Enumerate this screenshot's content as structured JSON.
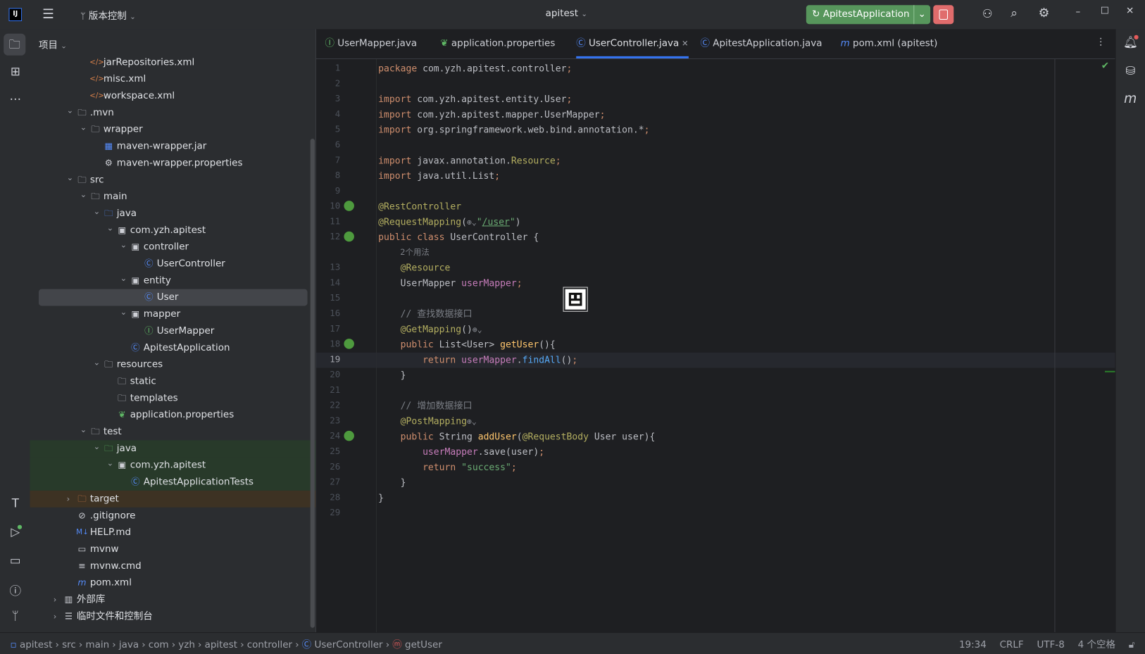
{
  "titlebar": {
    "app_icon": "IJ",
    "menu_icon": "hamburger-icon",
    "vcs_label": "版本控制",
    "project_name": "apitest",
    "run_config": "ApitestApplication",
    "run_color": "#57965c",
    "stop_color": "#e06c6c"
  },
  "project_panel": {
    "title": "项目",
    "items": [
      {
        "level": 2,
        "chev": "",
        "icon": "xml",
        "label": "jarRepositories.xml",
        "style": ""
      },
      {
        "level": 2,
        "chev": "",
        "icon": "xml",
        "label": "misc.xml",
        "style": ""
      },
      {
        "level": 2,
        "chev": "",
        "icon": "xml",
        "label": "workspace.xml",
        "style": ""
      },
      {
        "level": 1,
        "chev": "open",
        "icon": "folder",
        "label": ".mvn",
        "style": ""
      },
      {
        "level": 2,
        "chev": "open",
        "icon": "folder",
        "label": "wrapper",
        "style": ""
      },
      {
        "level": 3,
        "chev": "",
        "icon": "jar",
        "label": "maven-wrapper.jar",
        "style": ""
      },
      {
        "level": 3,
        "chev": "",
        "icon": "gear",
        "label": "maven-wrapper.properties",
        "style": ""
      },
      {
        "level": 1,
        "chev": "open",
        "icon": "folder",
        "label": "src",
        "style": ""
      },
      {
        "level": 2,
        "chev": "open",
        "icon": "folder",
        "label": "main",
        "style": ""
      },
      {
        "level": 3,
        "chev": "open",
        "icon": "srcfolder",
        "label": "java",
        "style": ""
      },
      {
        "level": 4,
        "chev": "open",
        "icon": "package",
        "label": "com.yzh.apitest",
        "style": ""
      },
      {
        "level": 5,
        "chev": "open",
        "icon": "package",
        "label": "controller",
        "style": ""
      },
      {
        "level": 6,
        "chev": "",
        "icon": "class",
        "label": "UserController",
        "style": ""
      },
      {
        "level": 5,
        "chev": "open",
        "icon": "package",
        "label": "entity",
        "style": ""
      },
      {
        "level": 6,
        "chev": "",
        "icon": "class",
        "label": "User",
        "style": "sel"
      },
      {
        "level": 5,
        "chev": "open",
        "icon": "package",
        "label": "mapper",
        "style": ""
      },
      {
        "level": 6,
        "chev": "",
        "icon": "interface",
        "label": "UserMapper",
        "style": ""
      },
      {
        "level": 5,
        "chev": "",
        "icon": "springclass",
        "label": "ApitestApplication",
        "style": ""
      },
      {
        "level": 3,
        "chev": "open",
        "icon": "resfolder",
        "label": "resources",
        "style": ""
      },
      {
        "level": 4,
        "chev": "",
        "icon": "folder",
        "label": "static",
        "style": ""
      },
      {
        "level": 4,
        "chev": "",
        "icon": "folder",
        "label": "templates",
        "style": ""
      },
      {
        "level": 4,
        "chev": "",
        "icon": "springprops",
        "label": "application.properties",
        "style": ""
      },
      {
        "level": 2,
        "chev": "open",
        "icon": "folder",
        "label": "test",
        "style": ""
      },
      {
        "level": 3,
        "chev": "open",
        "icon": "testfolder",
        "label": "java",
        "style": "green"
      },
      {
        "level": 4,
        "chev": "open",
        "icon": "package",
        "label": "com.yzh.apitest",
        "style": "green"
      },
      {
        "level": 5,
        "chev": "",
        "icon": "class",
        "label": "ApitestApplicationTests",
        "style": "green"
      },
      {
        "level": 1,
        "chev": "closed",
        "icon": "excluded",
        "label": "target",
        "style": "brown"
      },
      {
        "level": 1,
        "chev": "",
        "icon": "ignore",
        "label": ".gitignore",
        "style": ""
      },
      {
        "level": 1,
        "chev": "",
        "icon": "markdown",
        "label": "HELP.md",
        "style": ""
      },
      {
        "level": 1,
        "chev": "",
        "icon": "shell",
        "label": "mvnw",
        "style": ""
      },
      {
        "level": 1,
        "chev": "",
        "icon": "text",
        "label": "mvnw.cmd",
        "style": ""
      },
      {
        "level": 1,
        "chev": "",
        "icon": "maven",
        "label": "pom.xml",
        "style": ""
      },
      {
        "level": 0,
        "chev": "closed",
        "icon": "library",
        "label": "外部库",
        "style": ""
      },
      {
        "level": 0,
        "chev": "closed",
        "icon": "scratch",
        "label": "临时文件和控制台",
        "style": ""
      }
    ]
  },
  "tabs": [
    {
      "icon": "interface",
      "label": "UserMapper.java",
      "active": false
    },
    {
      "icon": "springprops",
      "label": "application.properties",
      "active": false
    },
    {
      "icon": "class",
      "label": "UserController.java",
      "active": true
    },
    {
      "icon": "springclass",
      "label": "ApitestApplication.java",
      "active": false
    },
    {
      "icon": "maven",
      "label": "pom.xml (apitest)",
      "active": false
    }
  ],
  "editor": {
    "current_line": 19,
    "inlay_hint": "2个用法",
    "lines": [
      {
        "n": 1,
        "t": [
          [
            "package ",
            "kw"
          ],
          [
            "com.yzh.apitest.controller",
            "id"
          ],
          [
            ";",
            "kw"
          ]
        ]
      },
      {
        "n": 2,
        "t": []
      },
      {
        "n": 3,
        "t": [
          [
            "import ",
            "kw"
          ],
          [
            "com.yzh.apitest.entity.User",
            "id"
          ],
          [
            ";",
            "kw"
          ]
        ]
      },
      {
        "n": 4,
        "t": [
          [
            "import ",
            "kw"
          ],
          [
            "com.yzh.apitest.mapper.UserMapper",
            "id"
          ],
          [
            ";",
            "kw"
          ]
        ]
      },
      {
        "n": 5,
        "t": [
          [
            "import ",
            "kw"
          ],
          [
            "org.springframework.web.bind.annotation.*",
            "id"
          ],
          [
            ";",
            "kw"
          ]
        ]
      },
      {
        "n": 6,
        "t": []
      },
      {
        "n": 7,
        "t": [
          [
            "import ",
            "kw"
          ],
          [
            "javax.annotation.",
            "id"
          ],
          [
            "Resource",
            "ann"
          ],
          [
            ";",
            "kw"
          ]
        ]
      },
      {
        "n": 8,
        "t": [
          [
            "import ",
            "kw"
          ],
          [
            "java.util.List",
            "id"
          ],
          [
            ";",
            "kw"
          ]
        ]
      },
      {
        "n": 9,
        "t": []
      },
      {
        "n": 10,
        "t": [
          [
            "@RestController",
            "ann"
          ]
        ],
        "gutter": "spring"
      },
      {
        "n": 11,
        "t": [
          [
            "@RequestMapping",
            "ann"
          ],
          [
            "(",
            "id"
          ],
          [
            "⊕⌄",
            "glyph"
          ],
          [
            "\"",
            "str"
          ],
          [
            "/user",
            "link"
          ],
          [
            "\"",
            "str"
          ],
          [
            ")",
            "id"
          ]
        ]
      },
      {
        "n": 12,
        "t": [
          [
            "public class ",
            "kw"
          ],
          [
            "UserController ",
            "id"
          ],
          [
            "{",
            "id"
          ]
        ],
        "gutter": "spring"
      },
      {
        "n": 13,
        "t": [
          [
            "    @Resource",
            "ann"
          ]
        ],
        "inlay_before": true
      },
      {
        "n": 14,
        "t": [
          [
            "    UserMapper ",
            "id"
          ],
          [
            "userMapper",
            "fld"
          ],
          [
            ";",
            "kw"
          ]
        ]
      },
      {
        "n": 15,
        "t": []
      },
      {
        "n": 16,
        "t": [
          [
            "    // 查找数据接口",
            "cm"
          ]
        ]
      },
      {
        "n": 17,
        "t": [
          [
            "    @GetMapping",
            "ann"
          ],
          [
            "()",
            "id"
          ],
          [
            "⊕⌄",
            "glyph"
          ]
        ]
      },
      {
        "n": 18,
        "t": [
          [
            "    public ",
            "kw"
          ],
          [
            "List<User> ",
            "id"
          ],
          [
            "getUser",
            "fdecl"
          ],
          [
            "(){",
            "id"
          ]
        ],
        "gutter": "web"
      },
      {
        "n": 19,
        "t": [
          [
            "        return ",
            "kw"
          ],
          [
            "userMapper",
            "fld"
          ],
          [
            ".",
            "id"
          ],
          [
            "findAll",
            "mcall"
          ],
          [
            "()",
            "id"
          ],
          [
            ";",
            "kw"
          ]
        ]
      },
      {
        "n": 20,
        "t": [
          [
            "    }",
            "id"
          ]
        ]
      },
      {
        "n": 21,
        "t": []
      },
      {
        "n": 22,
        "t": [
          [
            "    // 增加数据接口",
            "cm"
          ]
        ]
      },
      {
        "n": 23,
        "t": [
          [
            "    @PostMapping",
            "ann"
          ],
          [
            "⊕⌄",
            "glyph"
          ]
        ]
      },
      {
        "n": 24,
        "t": [
          [
            "    public ",
            "kw"
          ],
          [
            "String ",
            "id"
          ],
          [
            "addUser",
            "fdecl"
          ],
          [
            "(",
            "id"
          ],
          [
            "@RequestBody ",
            "ann"
          ],
          [
            "User user){",
            "id"
          ]
        ],
        "gutter": "web"
      },
      {
        "n": 25,
        "t": [
          [
            "        userMapper",
            "fld"
          ],
          [
            ".save(user)",
            "id"
          ],
          [
            ";",
            "kw"
          ]
        ]
      },
      {
        "n": 26,
        "t": [
          [
            "        return ",
            "kw"
          ],
          [
            "\"success\"",
            "str"
          ],
          [
            ";",
            "kw"
          ]
        ]
      },
      {
        "n": 27,
        "t": [
          [
            "    }",
            "id"
          ]
        ]
      },
      {
        "n": 28,
        "t": [
          [
            "}",
            "id"
          ]
        ]
      },
      {
        "n": 29,
        "t": []
      }
    ]
  },
  "status_bar": {
    "breadcrumbs": [
      "apitest",
      "src",
      "main",
      "java",
      "com",
      "yzh",
      "apitest",
      "controller",
      "UserController",
      "getUser"
    ],
    "position": "19:34",
    "line_ending": "CRLF",
    "encoding": "UTF-8",
    "indent": "4 个空格"
  }
}
